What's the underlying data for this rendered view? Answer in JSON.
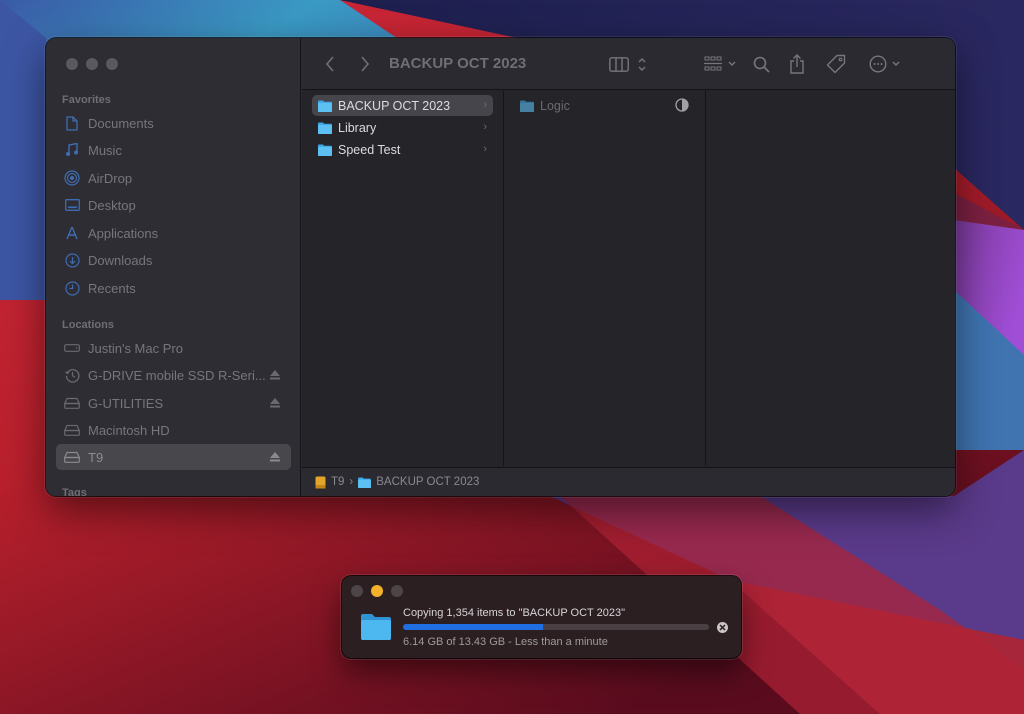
{
  "colors": {
    "accent": "#1f6fe2",
    "folder": "#3ea8e8",
    "minimize": "#f4b22a"
  },
  "finder": {
    "title": "BACKUP OCT 2023",
    "sidebar": {
      "favorites_label": "Favorites",
      "favorites": [
        {
          "label": "Documents",
          "icon": "document-icon"
        },
        {
          "label": "Music",
          "icon": "music-note-icon"
        },
        {
          "label": "AirDrop",
          "icon": "airdrop-icon"
        },
        {
          "label": "Desktop",
          "icon": "desktop-icon"
        },
        {
          "label": "Applications",
          "icon": "applications-icon"
        },
        {
          "label": "Downloads",
          "icon": "download-icon"
        },
        {
          "label": "Recents",
          "icon": "clock-icon"
        }
      ],
      "locations_label": "Locations",
      "locations": [
        {
          "label": "Justin's Mac Pro",
          "icon": "computer-icon",
          "eject": false,
          "selected": false
        },
        {
          "label": "G-DRIVE mobile SSD R-Seri...",
          "icon": "time-machine-icon",
          "eject": true,
          "selected": false
        },
        {
          "label": "G-UTILITIES",
          "icon": "drive-icon",
          "eject": true,
          "selected": false
        },
        {
          "label": "Macintosh HD",
          "icon": "drive-icon",
          "eject": false,
          "selected": false
        },
        {
          "label": "T9",
          "icon": "drive-icon",
          "eject": true,
          "selected": true
        }
      ],
      "tags_label": "Tags"
    },
    "toolbar": {
      "back": "back-icon",
      "forward": "forward-icon",
      "view": "column-view-icon",
      "group": "group-icon",
      "search": "search-icon",
      "share": "share-icon",
      "tag": "tag-icon",
      "more": "more-icon"
    },
    "columns": [
      [
        {
          "name": "BACKUP OCT 2023",
          "selected": true,
          "has_children": true
        },
        {
          "name": "Library",
          "selected": false,
          "has_children": true
        },
        {
          "name": "Speed Test",
          "selected": false,
          "has_children": true
        }
      ],
      [
        {
          "name": "Logic",
          "selected": false,
          "has_children": false,
          "dimmed": true,
          "status": "in-progress"
        }
      ]
    ],
    "pathbar": [
      {
        "label": "T9",
        "icon": "external-drive-icon"
      },
      {
        "label": "BACKUP OCT 2023",
        "icon": "folder-icon"
      }
    ]
  },
  "copy_dialog": {
    "title": "Copying 1,354 items to \"BACKUP OCT 2023\"",
    "progress_percent": 45.7,
    "copied": "6.14 GB",
    "total": "13.43 GB",
    "status": "6.14 GB of 13.43 GB - Less than a minute"
  }
}
